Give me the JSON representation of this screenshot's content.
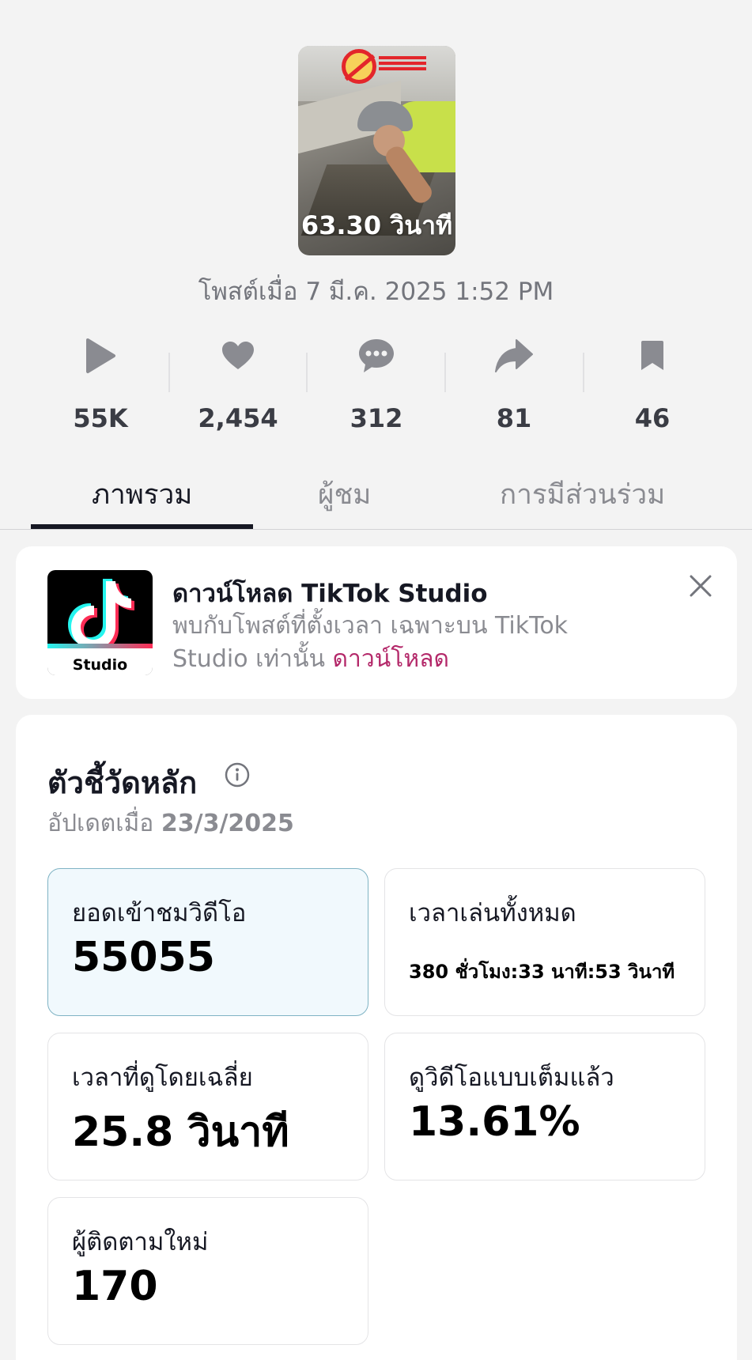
{
  "video": {
    "duration": "63.30 วินาที",
    "posted": "โพสต์เมื่อ 7 มี.ค. 2025 1:52 PM"
  },
  "stats": {
    "views": "55K",
    "likes": "2,454",
    "comments": "312",
    "shares": "81",
    "saves": "46"
  },
  "tabs": [
    "ภาพรวม",
    "ผู้ชม",
    "การมีส่วนร่วม"
  ],
  "banner": {
    "app_label": "Studio",
    "title": "ดาวน์โหลด TikTok Studio",
    "desc": "พบกับโพสต์ที่ตั้งเวลา เฉพาะบน TikTok Studio เท่านั้น",
    "link": "ดาวน์โหลด"
  },
  "metrics": {
    "title": "ตัวชี้วัดหลัก",
    "updated_prefix": "อัปเดตเมื่อ",
    "updated_date": "23/3/2025",
    "cards": [
      {
        "label": "ยอดเข้าชมวิดีโอ",
        "value": "55055"
      },
      {
        "label": "เวลาเล่นทั้งหมด",
        "value": "380 ชั่วโมง:33 นาที:53 วินาที"
      },
      {
        "label": "เวลาที่ดูโดยเฉลี่ย",
        "value": "25.8 วินาที"
      },
      {
        "label": "ดูวิดีโอแบบเต็มแล้ว",
        "value": "13.61%"
      },
      {
        "label": "ผู้ติดตามใหม่",
        "value": "170"
      }
    ]
  },
  "colors": {
    "accent_link": "#b4296a",
    "selected_card_bg": "#f1f9fd"
  }
}
